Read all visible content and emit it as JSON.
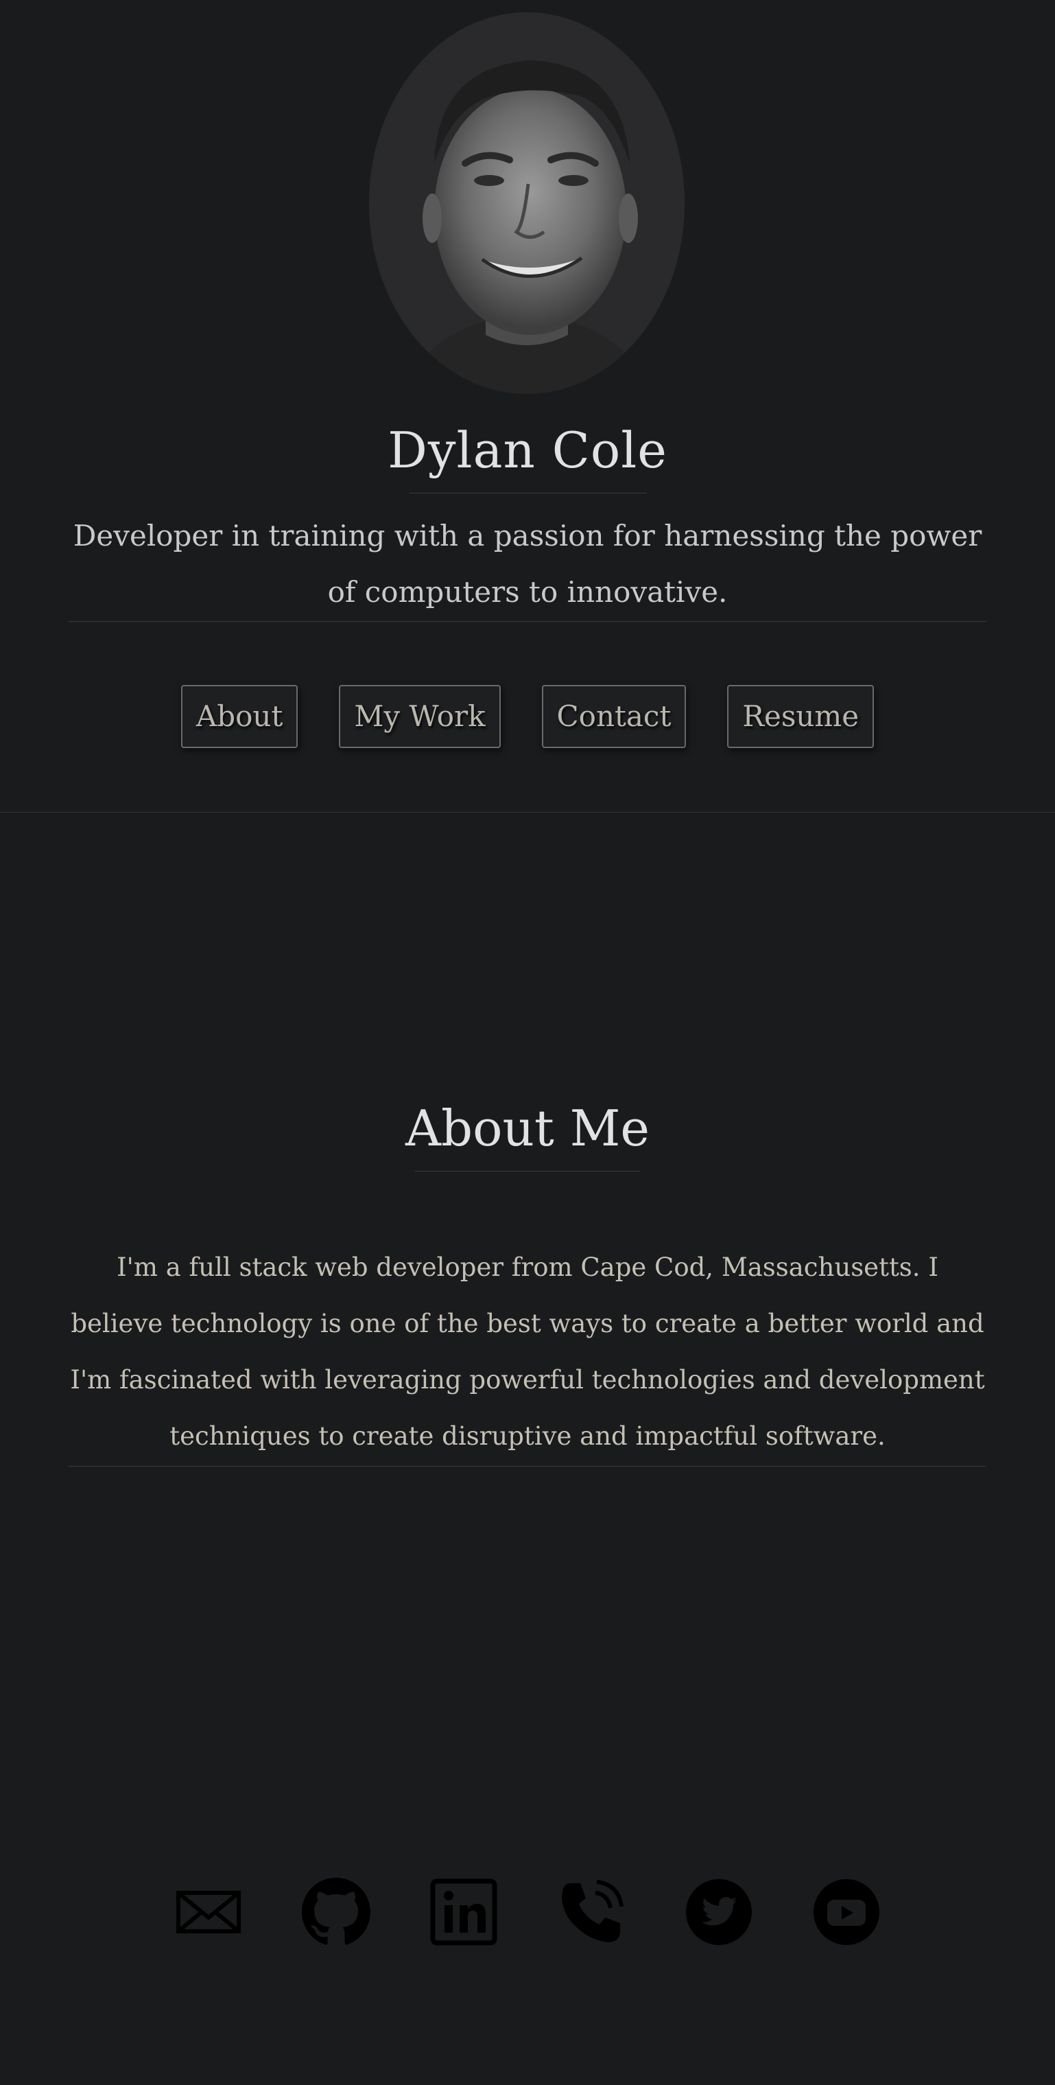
{
  "header": {
    "name": "Dylan Cole",
    "tagline": "Developer in training with a passion for harnessing the power of computers to innovative."
  },
  "nav": {
    "items": [
      {
        "label": "About"
      },
      {
        "label": "My Work"
      },
      {
        "label": "Contact"
      },
      {
        "label": "Resume"
      }
    ]
  },
  "about": {
    "title": "About Me",
    "text": "I'm a full stack web developer from Cape Cod, Massachusetts. I believe technology is one of the best ways to create a better world and I'm fascinated with leveraging powerful technologies and development techniques to create disruptive and impactful software."
  },
  "socials": [
    {
      "icon": "email-icon"
    },
    {
      "icon": "github-icon"
    },
    {
      "icon": "linkedin-icon"
    },
    {
      "icon": "phone-icon"
    },
    {
      "icon": "twitter-icon"
    },
    {
      "icon": "youtube-icon"
    }
  ],
  "colors": {
    "background": "#1a1b1d",
    "text": "#d6d6d6",
    "button_text": "#b9b7ae",
    "button_border": "#6a6a6a",
    "icon": "#000000"
  }
}
